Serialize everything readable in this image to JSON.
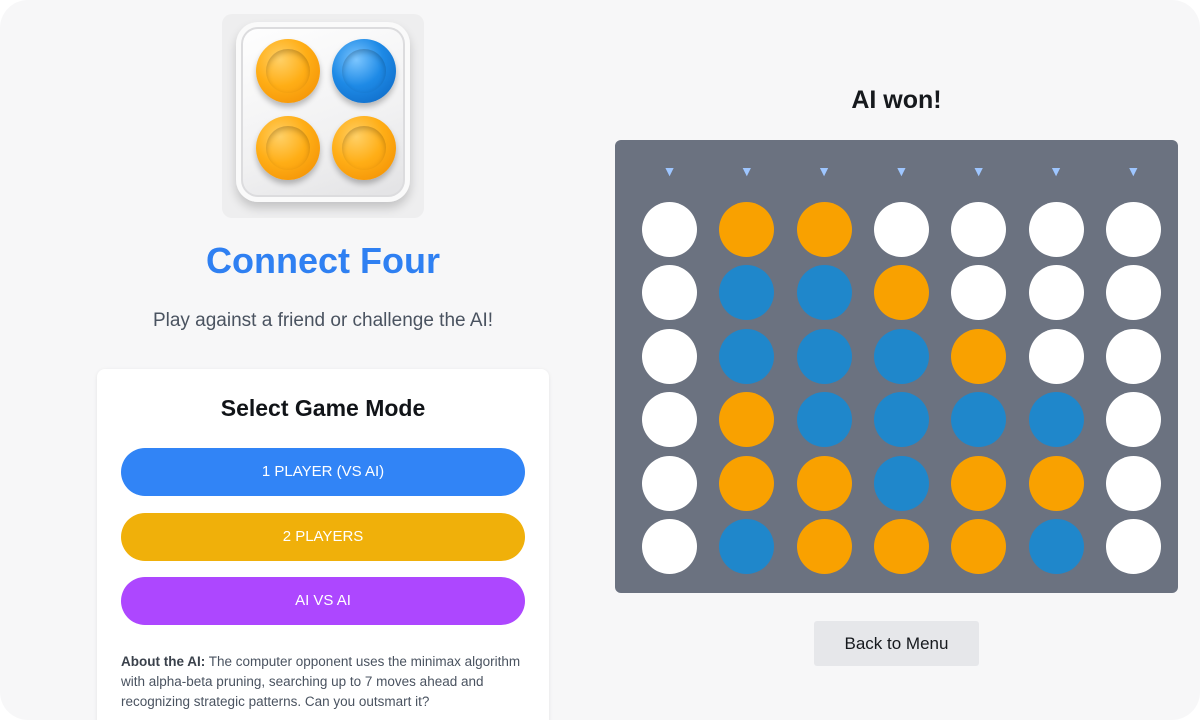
{
  "app": {
    "title": "Connect Four",
    "subtitle": "Play against a friend or challenge the AI!"
  },
  "logo": {
    "discs": [
      "orange",
      "blue",
      "orange",
      "orange"
    ]
  },
  "mode_select": {
    "heading": "Select Game Mode",
    "buttons": [
      {
        "label": "1 PLAYER (VS AI)",
        "color": "#3184f6"
      },
      {
        "label": "2 PLAYERS",
        "color": "#f0b00a"
      },
      {
        "label": "AI VS AI",
        "color": "#ad47ff"
      }
    ],
    "about_label": "About the AI:",
    "about_text": " The computer opponent uses the minimax algorithm with alpha-beta pruning, searching up to 7 moves ahead and recognizing strategic patterns. Can you outsmart it?"
  },
  "game": {
    "status": "AI won!",
    "back_label": "Back to Menu",
    "columns": 7,
    "rows": 6,
    "drop_arrow_glyph": "▼",
    "colors": {
      "board": "#6b7280",
      "empty": "#ffffff",
      "ai": "#f9a100",
      "player": "#1f87cb"
    },
    "board": [
      [
        "empty",
        "ai",
        "ai",
        "empty",
        "empty",
        "empty",
        "empty"
      ],
      [
        "empty",
        "player",
        "player",
        "ai",
        "empty",
        "empty",
        "empty"
      ],
      [
        "empty",
        "player",
        "player",
        "player",
        "ai",
        "empty",
        "empty"
      ],
      [
        "empty",
        "ai",
        "player",
        "player",
        "player",
        "player",
        "empty"
      ],
      [
        "empty",
        "ai",
        "ai",
        "player",
        "ai",
        "ai",
        "empty"
      ],
      [
        "empty",
        "player",
        "ai",
        "ai",
        "ai",
        "player",
        "empty"
      ]
    ]
  }
}
